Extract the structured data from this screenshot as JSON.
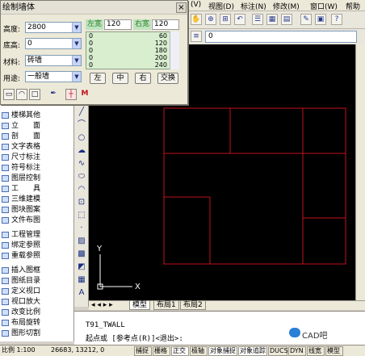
{
  "menubar": {
    "items": [
      "(V)",
      "视图(D)",
      "标注(N)",
      "修改(M)",
      "窗口(W)",
      "帮助"
    ]
  },
  "toolbar2": {
    "bylayer_value": "0"
  },
  "dialog": {
    "title": "绘制墙体",
    "close": "×",
    "height_label": "高度:",
    "height_value": "2800",
    "base_label": "底高:",
    "base_value": "0",
    "material_label": "材料:",
    "material_value": "砖墙",
    "usage_label": "用途:",
    "usage_value": "一般墙",
    "left_width_label": "左宽",
    "left_width_value": "120",
    "right_width_label": "右宽",
    "right_width_value": "120",
    "width_list": [
      {
        "a": "0",
        "b": "60"
      },
      {
        "a": "0",
        "b": "120"
      },
      {
        "a": "0",
        "b": "180"
      },
      {
        "a": "0",
        "b": "200"
      },
      {
        "a": "0",
        "b": "240"
      }
    ],
    "btn_left": "左",
    "btn_center": "中",
    "btn_right": "右",
    "btn_swap": "交换",
    "tool_m": "M"
  },
  "sidebar": {
    "items": [
      "楼梯其他",
      "立　　面",
      "剖　　面",
      "文字表格",
      "尺寸标注",
      "符号标注",
      "图层控制",
      "工　　具",
      "三维建模",
      "图块图案",
      "文件布图",
      "工程管理",
      "绑定参照",
      "重载参照",
      "插入图框",
      "图纸目录",
      "定义视口",
      "视口放大",
      "改变比例",
      "布局旋转",
      "图形切割"
    ]
  },
  "canvas": {
    "ucs_y": "Y",
    "ucs_x": "X"
  },
  "tabs": {
    "model": "模型",
    "layout1": "布局1",
    "layout2": "布局2"
  },
  "command": {
    "line1": "T91_TWALL",
    "line2": "起点或 [参考点(R)]<退出>:"
  },
  "statusbar": {
    "scale": "比例 1:100",
    "coords": "26683, 13212, 0",
    "toggles": [
      "捕捉",
      "栅格",
      "正交",
      "极轴",
      "对象捕捉",
      "对象追踪",
      "DUCS",
      "DYN",
      "线宽",
      "模型"
    ]
  },
  "watermark": {
    "text": "CAD吧"
  },
  "colors": {
    "wall_line": "#c0121b",
    "canvas_bg": "#000000",
    "ucs": "#ffffff"
  }
}
